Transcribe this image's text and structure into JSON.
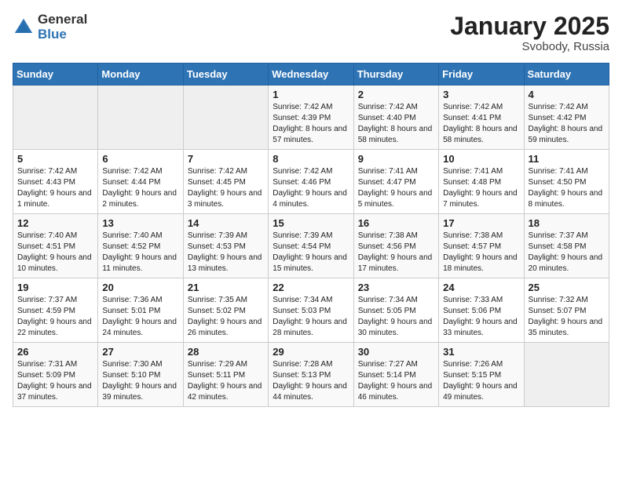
{
  "logo": {
    "text_general": "General",
    "text_blue": "Blue"
  },
  "title": "January 2025",
  "location": "Svobody, Russia",
  "days_of_week": [
    "Sunday",
    "Monday",
    "Tuesday",
    "Wednesday",
    "Thursday",
    "Friday",
    "Saturday"
  ],
  "weeks": [
    [
      {
        "day": "",
        "info": ""
      },
      {
        "day": "",
        "info": ""
      },
      {
        "day": "",
        "info": ""
      },
      {
        "day": "1",
        "info": "Sunrise: 7:42 AM\nSunset: 4:39 PM\nDaylight: 8 hours and 57 minutes."
      },
      {
        "day": "2",
        "info": "Sunrise: 7:42 AM\nSunset: 4:40 PM\nDaylight: 8 hours and 58 minutes."
      },
      {
        "day": "3",
        "info": "Sunrise: 7:42 AM\nSunset: 4:41 PM\nDaylight: 8 hours and 58 minutes."
      },
      {
        "day": "4",
        "info": "Sunrise: 7:42 AM\nSunset: 4:42 PM\nDaylight: 8 hours and 59 minutes."
      }
    ],
    [
      {
        "day": "5",
        "info": "Sunrise: 7:42 AM\nSunset: 4:43 PM\nDaylight: 9 hours and 1 minute."
      },
      {
        "day": "6",
        "info": "Sunrise: 7:42 AM\nSunset: 4:44 PM\nDaylight: 9 hours and 2 minutes."
      },
      {
        "day": "7",
        "info": "Sunrise: 7:42 AM\nSunset: 4:45 PM\nDaylight: 9 hours and 3 minutes."
      },
      {
        "day": "8",
        "info": "Sunrise: 7:42 AM\nSunset: 4:46 PM\nDaylight: 9 hours and 4 minutes."
      },
      {
        "day": "9",
        "info": "Sunrise: 7:41 AM\nSunset: 4:47 PM\nDaylight: 9 hours and 5 minutes."
      },
      {
        "day": "10",
        "info": "Sunrise: 7:41 AM\nSunset: 4:48 PM\nDaylight: 9 hours and 7 minutes."
      },
      {
        "day": "11",
        "info": "Sunrise: 7:41 AM\nSunset: 4:50 PM\nDaylight: 9 hours and 8 minutes."
      }
    ],
    [
      {
        "day": "12",
        "info": "Sunrise: 7:40 AM\nSunset: 4:51 PM\nDaylight: 9 hours and 10 minutes."
      },
      {
        "day": "13",
        "info": "Sunrise: 7:40 AM\nSunset: 4:52 PM\nDaylight: 9 hours and 11 minutes."
      },
      {
        "day": "14",
        "info": "Sunrise: 7:39 AM\nSunset: 4:53 PM\nDaylight: 9 hours and 13 minutes."
      },
      {
        "day": "15",
        "info": "Sunrise: 7:39 AM\nSunset: 4:54 PM\nDaylight: 9 hours and 15 minutes."
      },
      {
        "day": "16",
        "info": "Sunrise: 7:38 AM\nSunset: 4:56 PM\nDaylight: 9 hours and 17 minutes."
      },
      {
        "day": "17",
        "info": "Sunrise: 7:38 AM\nSunset: 4:57 PM\nDaylight: 9 hours and 18 minutes."
      },
      {
        "day": "18",
        "info": "Sunrise: 7:37 AM\nSunset: 4:58 PM\nDaylight: 9 hours and 20 minutes."
      }
    ],
    [
      {
        "day": "19",
        "info": "Sunrise: 7:37 AM\nSunset: 4:59 PM\nDaylight: 9 hours and 22 minutes."
      },
      {
        "day": "20",
        "info": "Sunrise: 7:36 AM\nSunset: 5:01 PM\nDaylight: 9 hours and 24 minutes."
      },
      {
        "day": "21",
        "info": "Sunrise: 7:35 AM\nSunset: 5:02 PM\nDaylight: 9 hours and 26 minutes."
      },
      {
        "day": "22",
        "info": "Sunrise: 7:34 AM\nSunset: 5:03 PM\nDaylight: 9 hours and 28 minutes."
      },
      {
        "day": "23",
        "info": "Sunrise: 7:34 AM\nSunset: 5:05 PM\nDaylight: 9 hours and 30 minutes."
      },
      {
        "day": "24",
        "info": "Sunrise: 7:33 AM\nSunset: 5:06 PM\nDaylight: 9 hours and 33 minutes."
      },
      {
        "day": "25",
        "info": "Sunrise: 7:32 AM\nSunset: 5:07 PM\nDaylight: 9 hours and 35 minutes."
      }
    ],
    [
      {
        "day": "26",
        "info": "Sunrise: 7:31 AM\nSunset: 5:09 PM\nDaylight: 9 hours and 37 minutes."
      },
      {
        "day": "27",
        "info": "Sunrise: 7:30 AM\nSunset: 5:10 PM\nDaylight: 9 hours and 39 minutes."
      },
      {
        "day": "28",
        "info": "Sunrise: 7:29 AM\nSunset: 5:11 PM\nDaylight: 9 hours and 42 minutes."
      },
      {
        "day": "29",
        "info": "Sunrise: 7:28 AM\nSunset: 5:13 PM\nDaylight: 9 hours and 44 minutes."
      },
      {
        "day": "30",
        "info": "Sunrise: 7:27 AM\nSunset: 5:14 PM\nDaylight: 9 hours and 46 minutes."
      },
      {
        "day": "31",
        "info": "Sunrise: 7:26 AM\nSunset: 5:15 PM\nDaylight: 9 hours and 49 minutes."
      },
      {
        "day": "",
        "info": ""
      }
    ]
  ]
}
